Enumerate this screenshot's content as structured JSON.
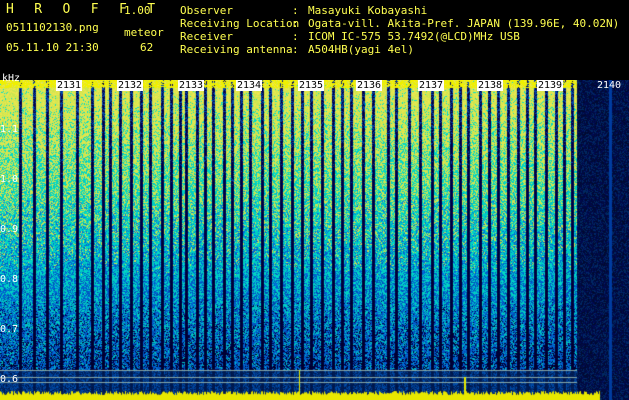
{
  "header": {
    "title": "H R O F F T",
    "version": "1.00",
    "filename": "0511102130.png",
    "meteor_label": "meteor",
    "datetime": "05.11.10 21:30",
    "meteor_count": "62"
  },
  "info": [
    {
      "key": "Observer",
      "value": "Masayuki Kobayashi"
    },
    {
      "key": "Receiving Location",
      "value": "Ogata-vill. Akita-Pref. JAPAN (139.96E, 40.02N)"
    },
    {
      "key": "Receiver",
      "value": "ICOM IC-575 53.7492(@LCD)MHz USB"
    },
    {
      "key": "Receiving antenna",
      "value": "A504HB(yagi 4el)"
    }
  ],
  "separator": ":",
  "axis": {
    "y_unit": "kHz",
    "y_ticks": [
      "1.1",
      "1.0",
      "0.9",
      "0.8",
      "0.7",
      "0.6"
    ],
    "x_ticks": [
      "2131",
      "2132",
      "2133",
      "2134",
      "2135",
      "2136",
      "2137",
      "2138",
      "2139",
      "2140"
    ]
  },
  "colors": {
    "text_yellow": "#ffff50",
    "background": "#000000"
  }
}
